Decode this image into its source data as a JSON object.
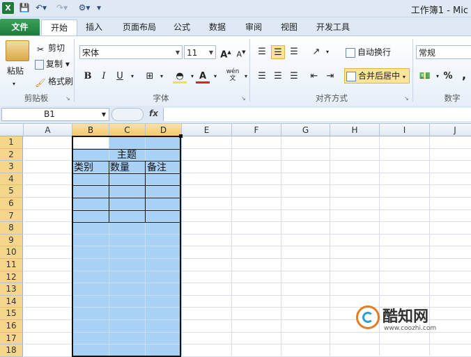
{
  "app": {
    "icon_letter": "X",
    "title": "工作簿1 - Mic"
  },
  "tabs": [
    "文件",
    "开始",
    "插入",
    "页面布局",
    "公式",
    "数据",
    "审阅",
    "视图",
    "开发工具"
  ],
  "clipboard": {
    "paste": "粘贴",
    "cut": "剪切",
    "copy": "复制",
    "format_painter": "格式刷",
    "group": "剪贴板"
  },
  "font": {
    "name": "宋体",
    "size": "11",
    "bold": "B",
    "italic": "I",
    "underline": "U",
    "group": "字体",
    "phonetic": "wén"
  },
  "alignment": {
    "wrap": "自动换行",
    "merge": "合并后居中",
    "group": "对齐方式"
  },
  "number": {
    "format": "常规",
    "percent": "%",
    "comma": ",",
    "group": "数字"
  },
  "namebox": "B1",
  "fx": "fx",
  "columns": [
    "A",
    "B",
    "C",
    "D",
    "E",
    "F",
    "G",
    "H",
    "I",
    "J"
  ],
  "rows": [
    "1",
    "2",
    "3",
    "4",
    "5",
    "6",
    "7",
    "8",
    "9",
    "10",
    "11",
    "12",
    "13",
    "14",
    "15",
    "16",
    "17",
    "18"
  ],
  "selected_columns": [
    "B",
    "C",
    "D"
  ],
  "cells": {
    "B2_merged": "主题",
    "B3": "类别",
    "C3": "数量",
    "D3": "备注"
  },
  "watermark": {
    "name": "酷知网",
    "url": "www.coozhi.com"
  },
  "colors": {
    "selection": "#a9d0f5",
    "ribbon_file": "#1f7a3a",
    "highlight": "#fde49b"
  }
}
